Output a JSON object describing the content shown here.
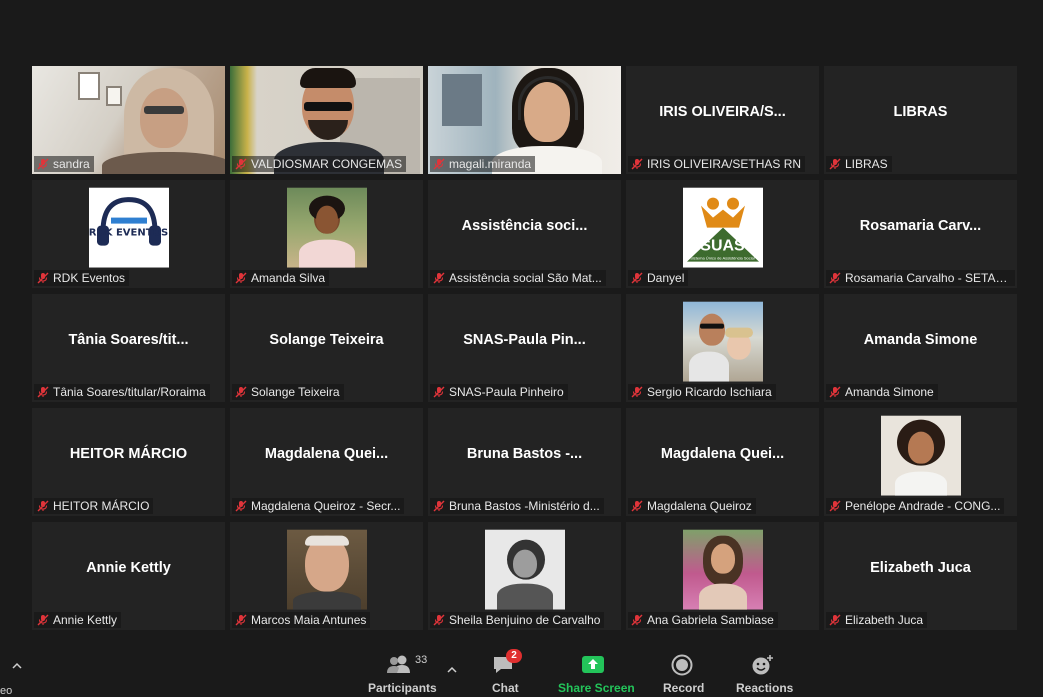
{
  "participants": [
    {
      "label": "sandra",
      "display": "",
      "type": "video-sandra"
    },
    {
      "label": "VALDIOSMAR CONGEMAS",
      "display": "",
      "type": "video-valdi"
    },
    {
      "label": "magali.miranda",
      "display": "",
      "type": "video-magali"
    },
    {
      "label": "IRIS OLIVEIRA/SETHAS RN",
      "display": "IRIS OLIVEIRA/S...",
      "type": "name"
    },
    {
      "label": "LIBRAS",
      "display": "LIBRAS",
      "type": "name"
    },
    {
      "label": "RDK Eventos",
      "display": "",
      "type": "avatar-rdk"
    },
    {
      "label": "Amanda Silva",
      "display": "",
      "type": "avatar-amanda"
    },
    {
      "label": "Assistência social São Mat...",
      "display": "Assistência soci...",
      "type": "name"
    },
    {
      "label": "Danyel",
      "display": "",
      "type": "avatar-suas"
    },
    {
      "label": "Rosamaria Carvalho - SETASC",
      "display": "Rosamaria  Carv...",
      "type": "name"
    },
    {
      "label": "Tânia Soares/titular/Roraima",
      "display": "Tânia  Soares/tit...",
      "type": "name"
    },
    {
      "label": "Solange Teixeira",
      "display": "Solange Teixeira",
      "type": "name"
    },
    {
      "label": "SNAS-Paula Pinheiro",
      "display": "SNAS-Paula  Pin...",
      "type": "name"
    },
    {
      "label": "Sergio Ricardo Ischiara",
      "display": "",
      "type": "avatar-sergio"
    },
    {
      "label": "Amanda Simone",
      "display": "Amanda Simone",
      "type": "name"
    },
    {
      "label": "HEITOR MÁRCIO",
      "display": "HEITOR MÁRCIO",
      "type": "name"
    },
    {
      "label": "Magdalena Queiroz - Secr...",
      "display": "Magdalena  Quei...",
      "type": "name"
    },
    {
      "label": "Bruna Bastos -Ministério d...",
      "display": "Bruna Bastos -...",
      "type": "name"
    },
    {
      "label": "Magdalena Queiroz",
      "display": "Magdalena  Quei...",
      "type": "name"
    },
    {
      "label": "Penélope Andrade - CONG...",
      "display": "",
      "type": "avatar-penelope"
    },
    {
      "label": "Annie Kettly",
      "display": "Annie Kettly",
      "type": "name"
    },
    {
      "label": "Marcos Maia Antunes",
      "display": "",
      "type": "avatar-marcos"
    },
    {
      "label": "Sheila Benjuino de Carvalho",
      "display": "",
      "type": "avatar-sheila"
    },
    {
      "label": "Ana Gabriela Sambiase",
      "display": "",
      "type": "avatar-ana"
    },
    {
      "label": "Elizabeth Juca",
      "display": "Elizabeth Juca",
      "type": "name"
    }
  ],
  "rdk_logo_text": "RDK EVENTOS",
  "suas_logo": {
    "title": "SUAS",
    "subtitle": "Sistema Único de Assistência Social"
  },
  "toolbar": {
    "left_caret": "^",
    "left_edge_text": "eo",
    "participants_label": "Participants",
    "participants_count": "33",
    "chat_label": "Chat",
    "chat_badge": "2",
    "share_label": "Share Screen",
    "record_label": "Record",
    "reactions_label": "Reactions"
  },
  "colors": {
    "background": "#1a1a1a",
    "tile": "#232323",
    "muted_icon": "#e0343a",
    "share_green": "#23c45a",
    "badge_red": "#e02f2f"
  }
}
